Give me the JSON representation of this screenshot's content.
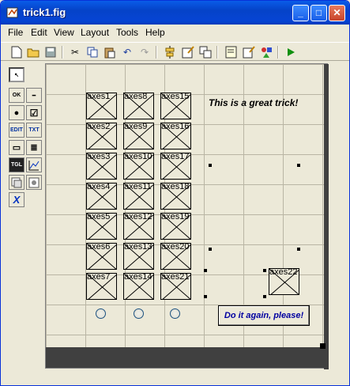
{
  "window": {
    "title": "trick1.fig"
  },
  "menu": [
    "File",
    "Edit",
    "View",
    "Layout",
    "Tools",
    "Help"
  ],
  "palette": [
    {
      "name": "select-arrow-tool-icon",
      "label": "↖"
    },
    {
      "name": "pushbutton-tool-icon",
      "label": "OK"
    },
    {
      "name": "slider-tool-icon",
      "label": "━"
    },
    {
      "name": "radiobutton-tool-icon",
      "label": "●"
    },
    {
      "name": "checkbox-tool-icon",
      "label": "☑"
    },
    {
      "name": "edit-text-tool-icon",
      "label": "EDIT"
    },
    {
      "name": "static-text-tool-icon",
      "label": "TXT"
    },
    {
      "name": "popup-menu-tool-icon",
      "label": "▭"
    },
    {
      "name": "listbox-tool-icon",
      "label": "≣"
    },
    {
      "name": "toggle-button-tool-icon",
      "label": "TGL"
    },
    {
      "name": "axes-tool-icon",
      "label": "📈"
    },
    {
      "name": "frame-tool-icon",
      "label": "▢"
    },
    {
      "name": "activex-tool-icon",
      "label": "▣"
    },
    {
      "name": "activex-x-tool-icon",
      "label": "X"
    }
  ],
  "axes": [
    [
      "axes1",
      "axes8",
      "axes15"
    ],
    [
      "axes2",
      "axes9",
      "axes16"
    ],
    [
      "axes3",
      "axes10",
      "axes17"
    ],
    [
      "axes4",
      "axes11",
      "axes18"
    ],
    [
      "axes5",
      "axes12",
      "axes19"
    ],
    [
      "axes6",
      "axes13",
      "axes20"
    ],
    [
      "axes7",
      "axes14",
      "axes21"
    ]
  ],
  "axes_single": "axes22",
  "static_text": "This is a great trick!",
  "button_label": "Do it again, please!",
  "colors": {
    "titlebar": "#0a5ce8",
    "button_text": "#0000a0"
  }
}
